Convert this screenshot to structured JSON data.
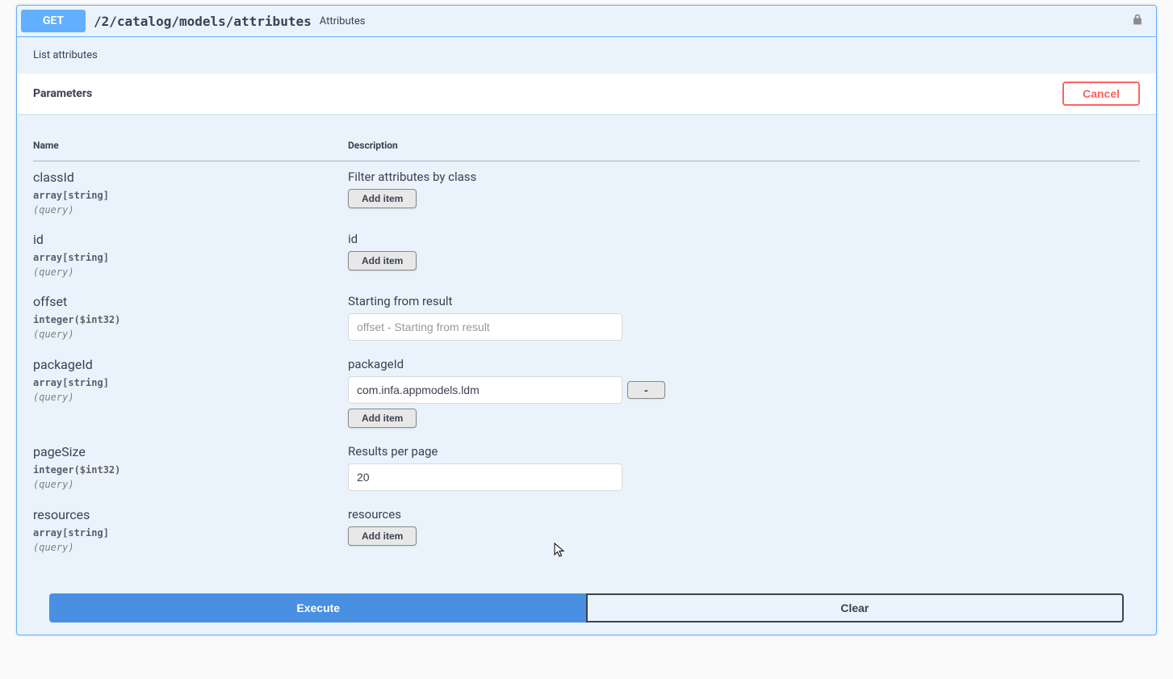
{
  "summary": {
    "method": "GET",
    "path": "/2/catalog/models/attributes",
    "description": "Attributes"
  },
  "opblock_description": "List attributes",
  "section": {
    "title": "Parameters",
    "cancel_label": "Cancel"
  },
  "table": {
    "headers": {
      "name": "Name",
      "description": "Description"
    }
  },
  "params": {
    "classId": {
      "name": "classId",
      "type": "array[string]",
      "in": "(query)",
      "description": "Filter attributes by class",
      "add_label": "Add item"
    },
    "id": {
      "name": "id",
      "type": "array[string]",
      "in": "(query)",
      "description": "id",
      "add_label": "Add item"
    },
    "offset": {
      "name": "offset",
      "type": "integer",
      "format": "($int32)",
      "in": "(query)",
      "description": "Starting from result",
      "placeholder": "offset - Starting from result",
      "value": ""
    },
    "packageId": {
      "name": "packageId",
      "type": "array[string]",
      "in": "(query)",
      "description": "packageId",
      "items": [
        "com.infa.appmodels.ldm"
      ],
      "remove_label": "-",
      "add_label": "Add item"
    },
    "pageSize": {
      "name": "pageSize",
      "type": "integer",
      "format": "($int32)",
      "in": "(query)",
      "description": "Results per page",
      "value": "20"
    },
    "resources": {
      "name": "resources",
      "type": "array[string]",
      "in": "(query)",
      "description": "resources",
      "add_label": "Add item"
    }
  },
  "actions": {
    "execute": "Execute",
    "clear": "Clear"
  }
}
